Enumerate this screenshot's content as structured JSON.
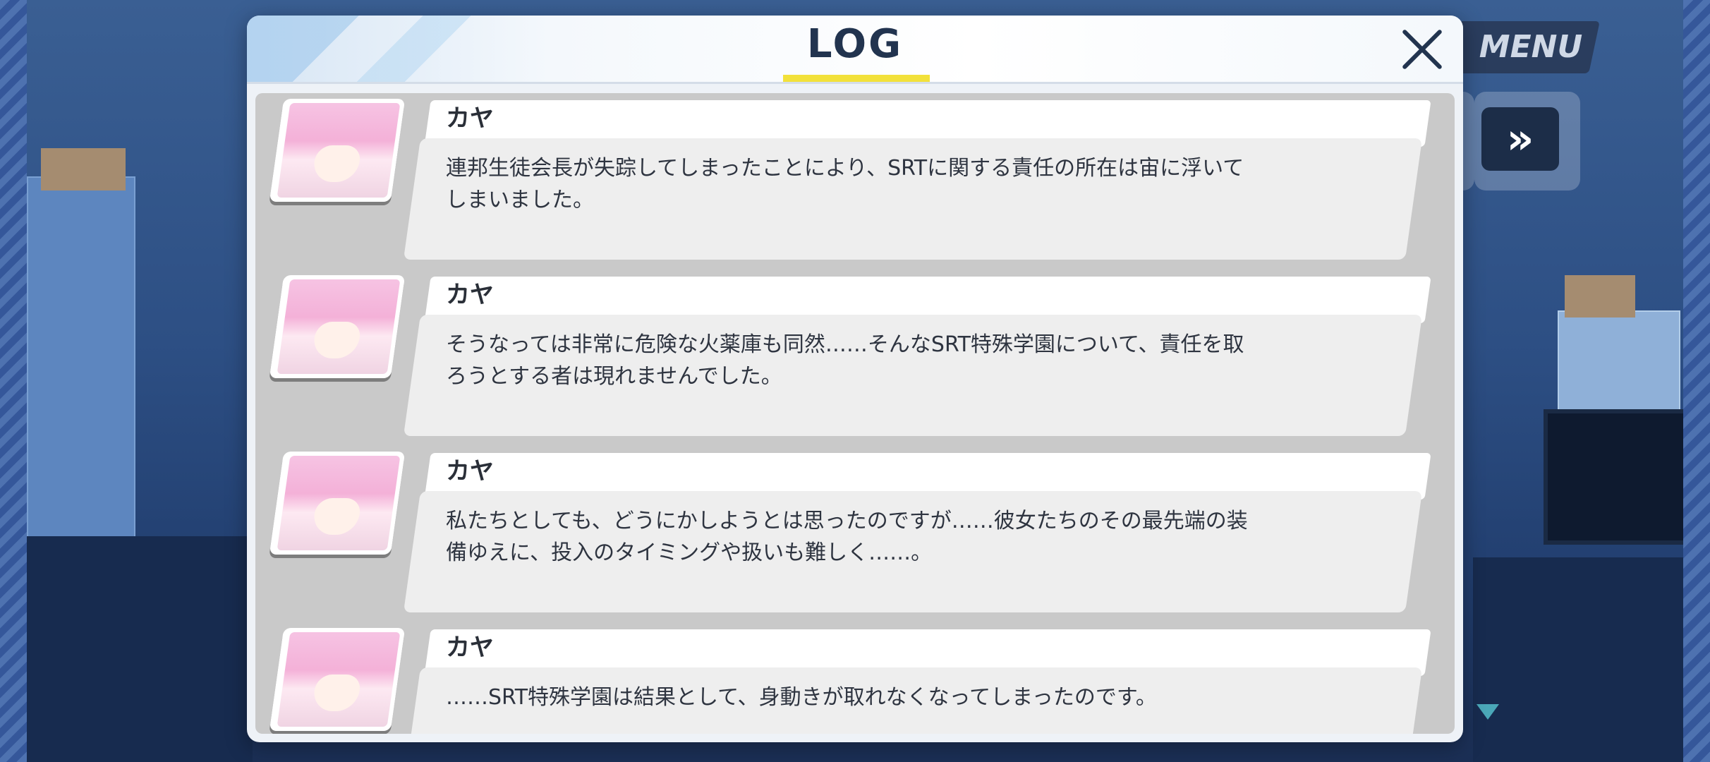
{
  "header": {
    "title": "LOG",
    "menu_label": "MENU",
    "fast_forward_label": "»"
  },
  "entries": [
    {
      "speaker": "カヤ",
      "text": "連邦生徒会長が失踪してしまったことにより、SRTに関する責任の所在は宙に浮いてしまいました。"
    },
    {
      "speaker": "カヤ",
      "text": "そうなっては非常に危険な火薬庫も同然……そんなSRT特殊学園について、責任を取ろうとする者は現れませんでした。"
    },
    {
      "speaker": "カヤ",
      "text": "私たちとしても、どうにかしようとは思ったのですが……彼女たちのその最先端の装備ゆえに、投入のタイミングや扱いも難しく……。"
    },
    {
      "speaker": "カヤ",
      "text": "……SRT特殊学園は結果として、身動きが取れなくなってしまったのです。"
    }
  ],
  "colors": {
    "title": "#22344f",
    "underline": "#f2e13a",
    "name_bar": "#ffffff",
    "text_box": "#eeeeee"
  },
  "icons": {
    "close": "close-icon",
    "scroll": "scroll-down-icon"
  }
}
